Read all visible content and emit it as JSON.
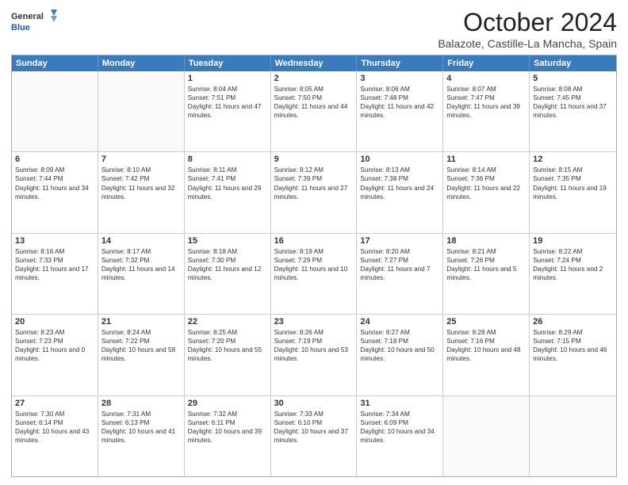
{
  "header": {
    "logo_general": "General",
    "logo_blue": "Blue",
    "month": "October 2024",
    "location": "Balazote, Castille-La Mancha, Spain"
  },
  "days_of_week": [
    "Sunday",
    "Monday",
    "Tuesday",
    "Wednesday",
    "Thursday",
    "Friday",
    "Saturday"
  ],
  "weeks": [
    [
      {
        "day": "",
        "sunrise": "",
        "sunset": "",
        "daylight": ""
      },
      {
        "day": "",
        "sunrise": "",
        "sunset": "",
        "daylight": ""
      },
      {
        "day": "1",
        "sunrise": "Sunrise: 8:04 AM",
        "sunset": "Sunset: 7:51 PM",
        "daylight": "Daylight: 11 hours and 47 minutes."
      },
      {
        "day": "2",
        "sunrise": "Sunrise: 8:05 AM",
        "sunset": "Sunset: 7:50 PM",
        "daylight": "Daylight: 11 hours and 44 minutes."
      },
      {
        "day": "3",
        "sunrise": "Sunrise: 8:06 AM",
        "sunset": "Sunset: 7:48 PM",
        "daylight": "Daylight: 11 hours and 42 minutes."
      },
      {
        "day": "4",
        "sunrise": "Sunrise: 8:07 AM",
        "sunset": "Sunset: 7:47 PM",
        "daylight": "Daylight: 11 hours and 39 minutes."
      },
      {
        "day": "5",
        "sunrise": "Sunrise: 8:08 AM",
        "sunset": "Sunset: 7:45 PM",
        "daylight": "Daylight: 11 hours and 37 minutes."
      }
    ],
    [
      {
        "day": "6",
        "sunrise": "Sunrise: 8:09 AM",
        "sunset": "Sunset: 7:44 PM",
        "daylight": "Daylight: 11 hours and 34 minutes."
      },
      {
        "day": "7",
        "sunrise": "Sunrise: 8:10 AM",
        "sunset": "Sunset: 7:42 PM",
        "daylight": "Daylight: 11 hours and 32 minutes."
      },
      {
        "day": "8",
        "sunrise": "Sunrise: 8:11 AM",
        "sunset": "Sunset: 7:41 PM",
        "daylight": "Daylight: 11 hours and 29 minutes."
      },
      {
        "day": "9",
        "sunrise": "Sunrise: 8:12 AM",
        "sunset": "Sunset: 7:39 PM",
        "daylight": "Daylight: 11 hours and 27 minutes."
      },
      {
        "day": "10",
        "sunrise": "Sunrise: 8:13 AM",
        "sunset": "Sunset: 7:38 PM",
        "daylight": "Daylight: 11 hours and 24 minutes."
      },
      {
        "day": "11",
        "sunrise": "Sunrise: 8:14 AM",
        "sunset": "Sunset: 7:36 PM",
        "daylight": "Daylight: 11 hours and 22 minutes."
      },
      {
        "day": "12",
        "sunrise": "Sunrise: 8:15 AM",
        "sunset": "Sunset: 7:35 PM",
        "daylight": "Daylight: 11 hours and 19 minutes."
      }
    ],
    [
      {
        "day": "13",
        "sunrise": "Sunrise: 8:16 AM",
        "sunset": "Sunset: 7:33 PM",
        "daylight": "Daylight: 11 hours and 17 minutes."
      },
      {
        "day": "14",
        "sunrise": "Sunrise: 8:17 AM",
        "sunset": "Sunset: 7:32 PM",
        "daylight": "Daylight: 11 hours and 14 minutes."
      },
      {
        "day": "15",
        "sunrise": "Sunrise: 8:18 AM",
        "sunset": "Sunset: 7:30 PM",
        "daylight": "Daylight: 11 hours and 12 minutes."
      },
      {
        "day": "16",
        "sunrise": "Sunrise: 8:19 AM",
        "sunset": "Sunset: 7:29 PM",
        "daylight": "Daylight: 11 hours and 10 minutes."
      },
      {
        "day": "17",
        "sunrise": "Sunrise: 8:20 AM",
        "sunset": "Sunset: 7:27 PM",
        "daylight": "Daylight: 11 hours and 7 minutes."
      },
      {
        "day": "18",
        "sunrise": "Sunrise: 8:21 AM",
        "sunset": "Sunset: 7:26 PM",
        "daylight": "Daylight: 11 hours and 5 minutes."
      },
      {
        "day": "19",
        "sunrise": "Sunrise: 8:22 AM",
        "sunset": "Sunset: 7:24 PM",
        "daylight": "Daylight: 11 hours and 2 minutes."
      }
    ],
    [
      {
        "day": "20",
        "sunrise": "Sunrise: 8:23 AM",
        "sunset": "Sunset: 7:23 PM",
        "daylight": "Daylight: 11 hours and 0 minutes."
      },
      {
        "day": "21",
        "sunrise": "Sunrise: 8:24 AM",
        "sunset": "Sunset: 7:22 PM",
        "daylight": "Daylight: 10 hours and 58 minutes."
      },
      {
        "day": "22",
        "sunrise": "Sunrise: 8:25 AM",
        "sunset": "Sunset: 7:20 PM",
        "daylight": "Daylight: 10 hours and 55 minutes."
      },
      {
        "day": "23",
        "sunrise": "Sunrise: 8:26 AM",
        "sunset": "Sunset: 7:19 PM",
        "daylight": "Daylight: 10 hours and 53 minutes."
      },
      {
        "day": "24",
        "sunrise": "Sunrise: 8:27 AM",
        "sunset": "Sunset: 7:18 PM",
        "daylight": "Daylight: 10 hours and 50 minutes."
      },
      {
        "day": "25",
        "sunrise": "Sunrise: 8:28 AM",
        "sunset": "Sunset: 7:16 PM",
        "daylight": "Daylight: 10 hours and 48 minutes."
      },
      {
        "day": "26",
        "sunrise": "Sunrise: 8:29 AM",
        "sunset": "Sunset: 7:15 PM",
        "daylight": "Daylight: 10 hours and 46 minutes."
      }
    ],
    [
      {
        "day": "27",
        "sunrise": "Sunrise: 7:30 AM",
        "sunset": "Sunset: 6:14 PM",
        "daylight": "Daylight: 10 hours and 43 minutes."
      },
      {
        "day": "28",
        "sunrise": "Sunrise: 7:31 AM",
        "sunset": "Sunset: 6:13 PM",
        "daylight": "Daylight: 10 hours and 41 minutes."
      },
      {
        "day": "29",
        "sunrise": "Sunrise: 7:32 AM",
        "sunset": "Sunset: 6:11 PM",
        "daylight": "Daylight: 10 hours and 39 minutes."
      },
      {
        "day": "30",
        "sunrise": "Sunrise: 7:33 AM",
        "sunset": "Sunset: 6:10 PM",
        "daylight": "Daylight: 10 hours and 37 minutes."
      },
      {
        "day": "31",
        "sunrise": "Sunrise: 7:34 AM",
        "sunset": "Sunset: 6:09 PM",
        "daylight": "Daylight: 10 hours and 34 minutes."
      },
      {
        "day": "",
        "sunrise": "",
        "sunset": "",
        "daylight": ""
      },
      {
        "day": "",
        "sunrise": "",
        "sunset": "",
        "daylight": ""
      }
    ]
  ]
}
